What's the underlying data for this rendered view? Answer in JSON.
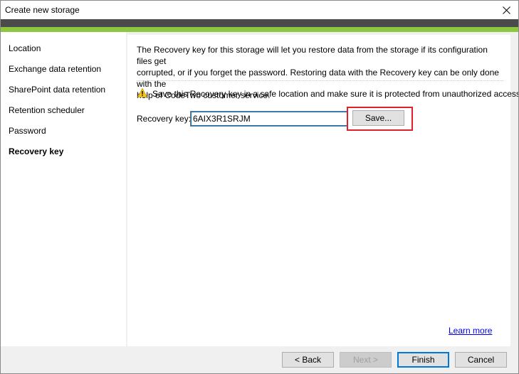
{
  "window": {
    "title": "Create new storage"
  },
  "sidebar": {
    "items": [
      {
        "label": "Location",
        "active": false
      },
      {
        "label": "Exchange data retention",
        "active": false
      },
      {
        "label": "SharePoint data retention",
        "active": false
      },
      {
        "label": "Retention scheduler",
        "active": false
      },
      {
        "label": "Password",
        "active": false
      },
      {
        "label": "Recovery key",
        "active": true
      }
    ]
  },
  "main": {
    "info_line1": "The Recovery key for this storage will let you restore data from the storage if its configuration files get",
    "info_line2": "corrupted, or if you forget the password. Restoring data with the Recovery key can be only done with the",
    "info_line3": "help of CodeTwo customer service.",
    "warning": "Save this Recovery key in a safe location and make sure it is protected from unauthorized access.",
    "recovery_key_label": "Recovery key:",
    "recovery_key_value": "6AIX3R1SRJM",
    "save_label": "Save...",
    "learn_more": "Learn more"
  },
  "footer": {
    "back_label": "< Back",
    "next_label": "Next >",
    "finish_label": "Finish",
    "cancel_label": "Cancel"
  },
  "colors": {
    "header_dark": "#4b4b4b",
    "header_green": "#8dc63f",
    "highlight": "#e0202a",
    "link": "#0000ee",
    "focus": "#0078d7"
  }
}
